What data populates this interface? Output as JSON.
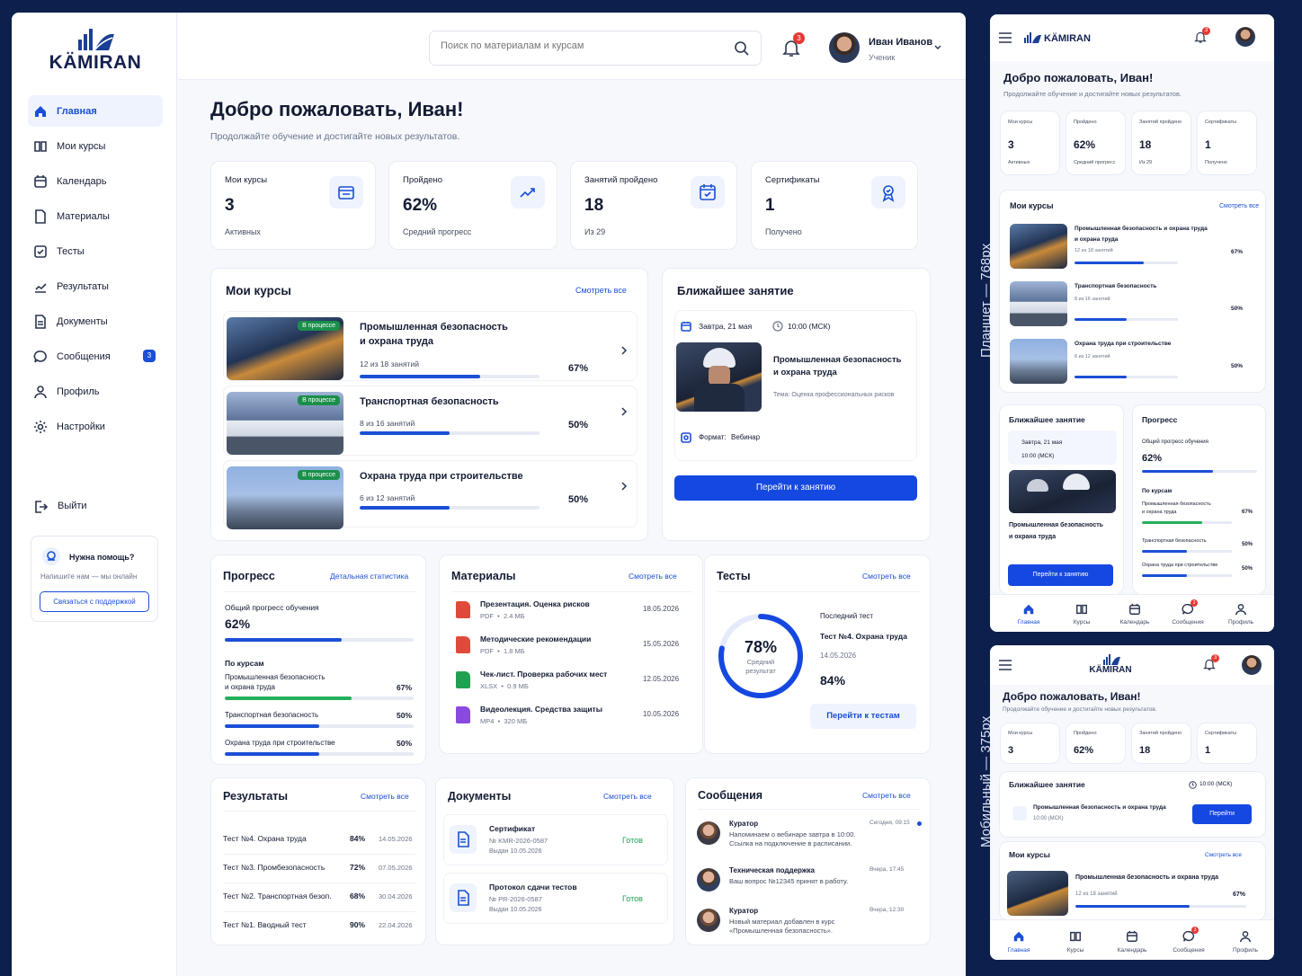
{
  "brand": "KÄMIRAN",
  "search": {
    "placeholder": "Поиск по материалам и курсам"
  },
  "notif_count": "3",
  "user": {
    "name": "Иван Иванов",
    "role": "Ученик"
  },
  "sidebar": {
    "items": [
      {
        "label": "Главная"
      },
      {
        "label": "Мои курсы"
      },
      {
        "label": "Календарь"
      },
      {
        "label": "Материалы"
      },
      {
        "label": "Тесты"
      },
      {
        "label": "Результаты"
      },
      {
        "label": "Документы"
      },
      {
        "label": "Сообщения",
        "badge": "3"
      },
      {
        "label": "Профиль"
      },
      {
        "label": "Настройки"
      }
    ],
    "logout": "Выйти",
    "help": {
      "title": "Нужна помощь?",
      "text": "Напишите нам — мы онлайн",
      "button": "Связаться с поддержкой"
    }
  },
  "welcome": {
    "title": "Добро пожаловать, Иван!",
    "subtitle": "Продолжайте обучение и достигайте новых результатов."
  },
  "stats": [
    {
      "label": "Мои курсы",
      "value": "3",
      "sub": "Активных",
      "icon": "folder-icon"
    },
    {
      "label": "Пройдено",
      "value": "62%",
      "sub": "Средний прогресс",
      "icon": "trend-icon"
    },
    {
      "label": "Занятий пройдено",
      "value": "18",
      "sub": "Из 29",
      "icon": "calendar-check-icon"
    },
    {
      "label": "Сертификаты",
      "value": "1",
      "sub": "Получено",
      "icon": "award-icon"
    }
  ],
  "courses": {
    "title": "Мои курсы",
    "link": "Смотреть все",
    "items": [
      {
        "title1": "Промышленная безопасность",
        "title2": "и охрана труда",
        "lessons": "12 из 18 занятий",
        "percent": "67%",
        "progress": 0.67,
        "tag": "В процессе"
      },
      {
        "title1": "Транспортная безопасность",
        "title2": "",
        "lessons": "8 из 16 занятий",
        "percent": "50%",
        "progress": 0.5,
        "tag": "В процессе"
      },
      {
        "title1": "Охрана труда при строительстве",
        "title2": "",
        "lessons": "6 из 12 занятий",
        "percent": "50%",
        "progress": 0.5,
        "tag": "В процессе"
      }
    ]
  },
  "next_lesson": {
    "title": "Ближайшее занятие",
    "date": "Завтра, 21 мая",
    "time": "10:00 (МСК)",
    "course1": "Промышленная безопасность",
    "course2": "и охрана труда",
    "topic": "Тема: Оценка профессиональных рисков",
    "format_label": "Формат:",
    "format_value": "Вебинар",
    "button": "Перейти к занятию"
  },
  "progress": {
    "title": "Прогресс",
    "link": "Детальная статистика",
    "overall_label": "Общий прогресс обучения",
    "overall": "62%",
    "overall_value": 0.62,
    "by_courses": "По курсам",
    "items": [
      {
        "name1": "Промышленная безопасность",
        "name2": "и охрана труда",
        "percent": "67%",
        "value": 0.67
      },
      {
        "name1": "Транспортная безопасность",
        "name2": "",
        "percent": "50%",
        "value": 0.5
      },
      {
        "name1": "Охрана труда при строительстве",
        "name2": "",
        "percent": "50%",
        "value": 0.5
      }
    ]
  },
  "materials": {
    "title": "Материалы",
    "link": "Смотреть все",
    "items": [
      {
        "name": "Презентация. Оценка рисков",
        "meta": "PDF  •  2.4 МБ",
        "date": "18.05.2026",
        "color": "#e04a3a"
      },
      {
        "name": "Методические рекомендации",
        "meta": "PDF  •  1.8 МБ",
        "date": "15.05.2026",
        "color": "#e04a3a"
      },
      {
        "name": "Чек-лист. Проверка рабочих мест",
        "meta": "XLSX  •  0.9 МБ",
        "date": "12.05.2026",
        "color": "#22a052"
      },
      {
        "name": "Видеолекция. Средства защиты",
        "meta": "MP4  •  320 МБ",
        "date": "10.05.2026",
        "color": "#8a4ae0"
      }
    ]
  },
  "tests": {
    "title": "Тесты",
    "link": "Смотреть все",
    "avg": "78%",
    "avg_value": 0.78,
    "avg_label1": "Средний",
    "avg_label2": "результат",
    "last_label": "Последний тест",
    "last_name": "Тест №4. Охрана труда",
    "last_date": "14.05.2026",
    "last_score": "84%",
    "button": "Перейти к тестам"
  },
  "results": {
    "title": "Результаты",
    "link": "Смотреть все",
    "items": [
      {
        "name": "Тест №4. Охрана труда",
        "score": "84%",
        "date": "14.05.2026"
      },
      {
        "name": "Тест №3. Промбезопасность",
        "score": "72%",
        "date": "07.05.2026"
      },
      {
        "name": "Тест №2. Транспортная безоп.",
        "score": "68%",
        "date": "30.04.2026"
      },
      {
        "name": "Тест №1. Вводный тест",
        "score": "90%",
        "date": "22.04.2026"
      }
    ]
  },
  "documents": {
    "title": "Документы",
    "link": "Смотреть все",
    "items": [
      {
        "name": "Сертификат",
        "number": "№ KMR-2026-0587",
        "issued": "Выдан 10.05.2026",
        "status": "Готов"
      },
      {
        "name": "Протокол сдачи тестов",
        "number": "№ PR-2026-0587",
        "issued": "Выдан 10.05.2026",
        "status": "Готов"
      }
    ]
  },
  "messages": {
    "title": "Сообщения",
    "link": "Смотреть все",
    "items": [
      {
        "from": "Куратор",
        "time": "Сегодня, 09:15",
        "text1": "Напоминаем о вебинаре завтра в 10:00.",
        "text2": "Ссылка на подключение в расписании."
      },
      {
        "from": "Техническая поддержка",
        "time": "Вчера, 17:45",
        "text1": "Ваш вопрос №12345 принят в работу.",
        "text2": ""
      },
      {
        "from": "Куратор",
        "time": "Вчера, 12:30",
        "text1": "Новый материал добавлен в курс",
        "text2": "«Промышленная безопасность»."
      }
    ]
  },
  "tablet": {
    "label": "Планшет — 768px",
    "welcome": "Добро пожаловать, Иван!",
    "subtitle": "Продолжайте обучение и достигайте новых результатов.",
    "stats": [
      {
        "label": "Мои курсы",
        "value": "3",
        "sub": "Активных"
      },
      {
        "label": "Пройдено",
        "value": "62%",
        "sub": "Средний прогресс"
      },
      {
        "label": "Занятий пройдено",
        "value": "18",
        "sub": "Из 29"
      },
      {
        "label": "Сертификаты",
        "value": "1",
        "sub": "Получено"
      }
    ],
    "courses_title": "Мои курсы",
    "courses_link": "Смотреть все",
    "courses": [
      {
        "t1": "Промышленная безопасность и охрана труда",
        "t2": "и охрана труда",
        "lessons": "12 из 18 занятий",
        "percent": "67%",
        "progress": 0.67
      },
      {
        "t1": "Транспортная безопасность",
        "t2": "",
        "lessons": "8 из 16 занятий",
        "percent": "50%",
        "progress": 0.5
      },
      {
        "t1": "Охрана труда при строительстве",
        "t2": "",
        "lessons": "6 из 12 занятий",
        "percent": "50%",
        "progress": 0.5
      }
    ],
    "next_title": "Ближайшее занятие",
    "next_date": "Завтра, 21 мая",
    "next_time": "10:00 (МСК)",
    "next_course1": "Промышленная безопасность",
    "next_course2": "и охрана труда",
    "next_button": "Перейти к занятию",
    "progress_title": "Прогресс",
    "progress_overall_label": "Общий прогресс обучения",
    "progress_overall": "62%",
    "progress_overall_value": 0.62,
    "progress_by": "По курсам",
    "progress_items": [
      {
        "n1": "Промышленная безопасность",
        "n2": "и охрана труда",
        "p": "67%",
        "v": 0.67
      },
      {
        "n1": "Транспортная безопасность",
        "n2": "",
        "p": "50%",
        "v": 0.5
      },
      {
        "n1": "Охрана труда при строительстве",
        "n2": "",
        "p": "50%",
        "v": 0.5
      }
    ]
  },
  "mobile": {
    "label": "Мобильный — 375px",
    "welcome": "Добро пожаловать, Иван!",
    "subtitle": "Продолжайте обучение и достигайте новых результатов.",
    "stats": [
      {
        "label": "Мои курсы",
        "value": "3"
      },
      {
        "label": "Пройдено",
        "value": "62%"
      },
      {
        "label": "Занятий пройдено",
        "value": "18"
      },
      {
        "label": "Сертификаты",
        "value": "1"
      }
    ],
    "next_title": "Ближайшее занятие",
    "next_time": "10:00 (МСК)",
    "next_course": "Промышленная безопасность и охрана труда",
    "next_sub": "10:00 (МСК)",
    "next_button": "Перейти",
    "courses_title": "Мои курсы",
    "courses_link": "Смотреть все",
    "course_name": "Промышленная безопасность и охрана труда",
    "course_lessons": "12 из 18 занятий",
    "course_percent": "67%",
    "course_progress": 0.67
  },
  "bottom_nav": [
    {
      "label": "Главная"
    },
    {
      "label": "Курсы"
    },
    {
      "label": "Календарь"
    },
    {
      "label": "Сообщения"
    },
    {
      "label": "Профиль"
    }
  ]
}
